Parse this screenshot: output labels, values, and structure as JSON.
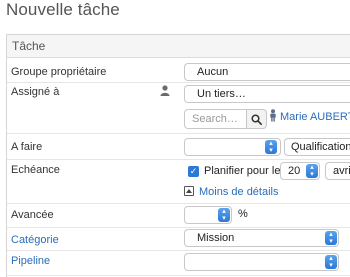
{
  "page": {
    "title": "Nouvelle tâche"
  },
  "panel": {
    "header": "Tâche"
  },
  "fields": {
    "groupe": {
      "label": "Groupe propriétaire",
      "value": "Aucun"
    },
    "assigne": {
      "label": "Assigné à",
      "value": "Un tiers…",
      "search_placeholder": "Search…",
      "user_name": "Marie AUBERT"
    },
    "a_faire": {
      "label": "A faire",
      "value": "",
      "second_value": "Qualification c"
    },
    "echeance": {
      "label": "Echéance",
      "checkbox_label": "Planifier pour le",
      "checked": true,
      "day": "20",
      "month": "avri"
    },
    "moins_details": {
      "label": "Moins de détails"
    },
    "avancee": {
      "label": "Avancée",
      "value": "",
      "unit": "%"
    },
    "categorie": {
      "label": "Catégorie",
      "value": "Mission"
    },
    "pipeline": {
      "label": "Pipeline",
      "value": ""
    }
  },
  "colors": {
    "accent": "#2b78d6",
    "link": "#2a6ebb"
  },
  "icons": {
    "assigne_person": "person-silhouette-icon",
    "search": "magnifier-icon",
    "user": "user-icon",
    "collapse": "collapse-square-icon",
    "dropdown": "chevron-up-down-icon"
  }
}
